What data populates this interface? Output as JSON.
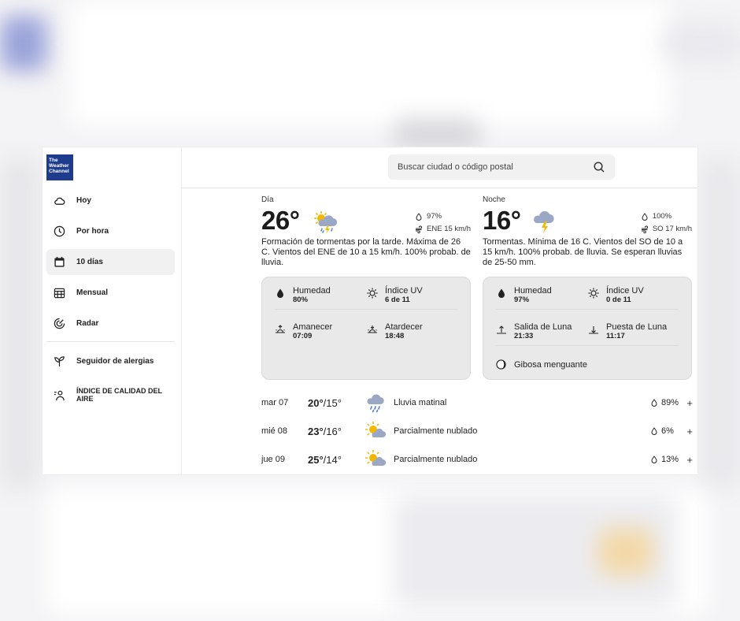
{
  "brand": {
    "line1": "The",
    "line2": "Weather",
    "line3": "Channel",
    "color": "#1f3b8e"
  },
  "nav": {
    "items": [
      {
        "label": "Hoy",
        "icon": "cloud-icon"
      },
      {
        "label": "Por hora",
        "icon": "clock-icon"
      },
      {
        "label": "10 días",
        "icon": "calendar-icon",
        "active": true
      },
      {
        "label": "Mensual",
        "icon": "calendar-grid-icon"
      },
      {
        "label": "Radar",
        "icon": "radar-icon"
      }
    ],
    "extra": [
      {
        "label": "Seguidor de alergias",
        "icon": "plant-icon"
      },
      {
        "label": "ÍNDICE DE CALIDAD DEL AIRE",
        "icon": "air-quality-icon"
      }
    ]
  },
  "search": {
    "placeholder": "Buscar ciudad o código postal"
  },
  "day": {
    "period": "Día",
    "temp": "26°",
    "icon": "thunderstorm-sun-icon",
    "precip": "97%",
    "wind": "ENE 15 km/h",
    "description": "Formación de tormentas por la tarde. Máxima de 26 C. Vientos del ENE de 10 a 15 km/h. 100% probab. de lluvia.",
    "humidity_label": "Humedad",
    "humidity": "80%",
    "uv_label": "Índice UV",
    "uv": "6 de 11",
    "sunrise_label": "Amanecer",
    "sunrise": "07:09",
    "sunset_label": "Atardecer",
    "sunset": "18:48"
  },
  "night": {
    "period": "Noche",
    "temp": "16°",
    "icon": "thunderstorm-icon",
    "precip": "100%",
    "wind": "SO 17 km/h",
    "description": "Tormentas. Mínima de 16 C. Vientos del SO de 10 a 15 km/h. 100% probab. de lluvia. Se esperan lluvias de 25-50 mm.",
    "humidity_label": "Humedad",
    "humidity": "97%",
    "uv_label": "Índice UV",
    "uv": "0 de 11",
    "moonrise_label": "Salida de Luna",
    "moonrise": "21:33",
    "moonset_label": "Puesta de Luna",
    "moonset": "11:17",
    "moon_phase": "Gibosa menguante"
  },
  "forecast": [
    {
      "date": "mar 07",
      "high": "20°",
      "low": "/15°",
      "icon": "rain-icon",
      "condition": "Lluvia matinal",
      "precip": "89%",
      "expand": "+"
    },
    {
      "date": "mié 08",
      "high": "23°",
      "low": "/16°",
      "icon": "partly-cloudy-icon",
      "condition": "Parcialmente nublado",
      "precip": "6%",
      "expand": "+"
    },
    {
      "date": "jue 09",
      "high": "25°",
      "low": "/14°",
      "icon": "partly-cloudy-icon",
      "condition": "Parcialmente nublado",
      "precip": "13%",
      "expand": "+"
    }
  ]
}
